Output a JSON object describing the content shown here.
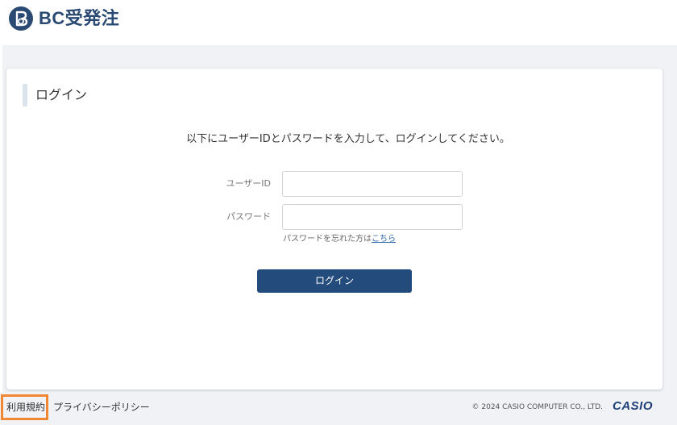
{
  "header": {
    "logo_text": "BC受発注"
  },
  "card": {
    "title": "ログイン",
    "instruction": "以下にユーザーIDとパスワードを入力して、ログインしてください。"
  },
  "form": {
    "user_id_label": "ユーザーID",
    "user_id_value": "",
    "password_label": "パスワード",
    "password_value": "",
    "forgot_text": "パスワードを忘れた方は",
    "forgot_link": "こちら",
    "login_button": "ログイン"
  },
  "footer": {
    "terms_link": "利用規約",
    "privacy_link": "プライバシーポリシー",
    "copyright": "© 2024 CASIO COMPUTER CO., LTD.",
    "brand_logo": "CASIO"
  },
  "colors": {
    "brand_navy": "#234b7c",
    "page_background": "#f1f2f6",
    "highlight_orange": "#f08732",
    "link_blue": "#2a67a8"
  },
  "icons": {
    "logo_mark": "bc-logo-icon"
  }
}
